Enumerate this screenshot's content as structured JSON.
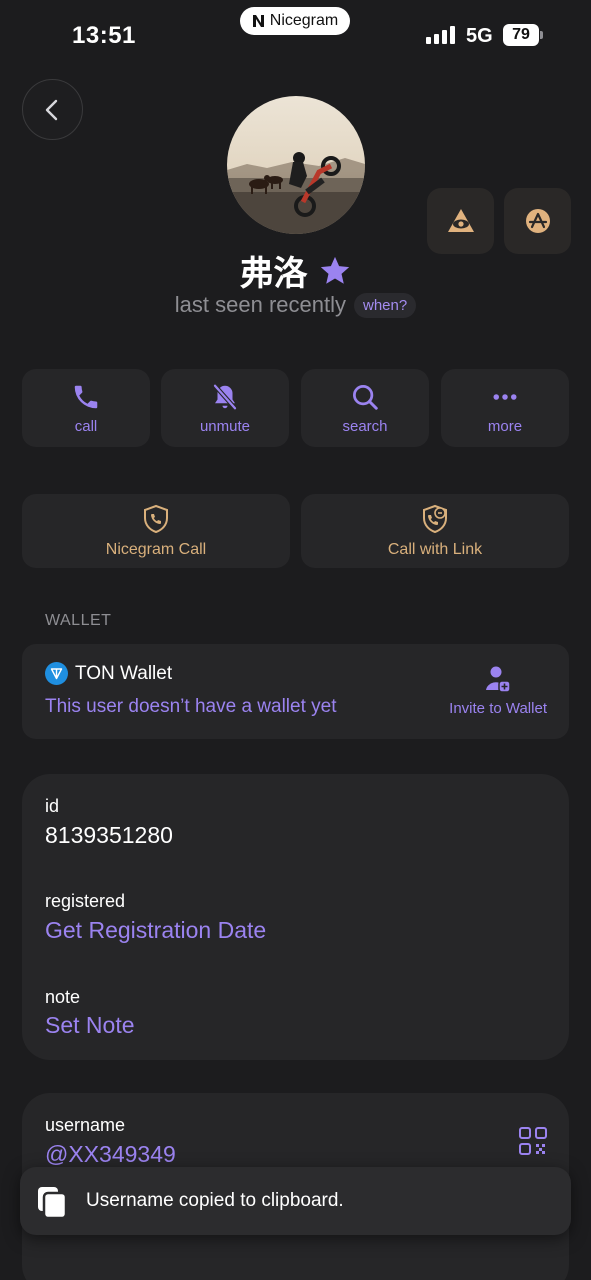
{
  "status_bar": {
    "time": "13:51",
    "brand": "Nicegram",
    "network": "5G",
    "battery": "79"
  },
  "profile": {
    "name": "弗洛",
    "status": "last seen recently",
    "when_label": "when?"
  },
  "actions": [
    {
      "label": "call",
      "icon": "phone-icon"
    },
    {
      "label": "unmute",
      "icon": "bell-slash-icon"
    },
    {
      "label": "search",
      "icon": "search-icon"
    },
    {
      "label": "more",
      "icon": "ellipsis-icon"
    }
  ],
  "nicegram_actions": [
    {
      "label": "Nicegram Call",
      "icon": "shield-phone-icon"
    },
    {
      "label": "Call with Link",
      "icon": "shield-link-icon"
    }
  ],
  "wallet": {
    "section_title": "WALLET",
    "title": "TON Wallet",
    "subtitle": "This user doesn’t have a wallet yet",
    "invite_label": "Invite to Wallet"
  },
  "info": {
    "id_label": "id",
    "id_value": "8139351280",
    "registered_label": "registered",
    "registered_value": "Get Registration Date",
    "note_label": "note",
    "note_value": "Set Note"
  },
  "username": {
    "label": "username",
    "value": "@XX349349"
  },
  "toast": {
    "message": "Username copied to clipboard."
  },
  "colors": {
    "accent": "#9b83f0",
    "gold": "#d9b07c",
    "background": "#1c1c1e",
    "card": "#262628"
  }
}
